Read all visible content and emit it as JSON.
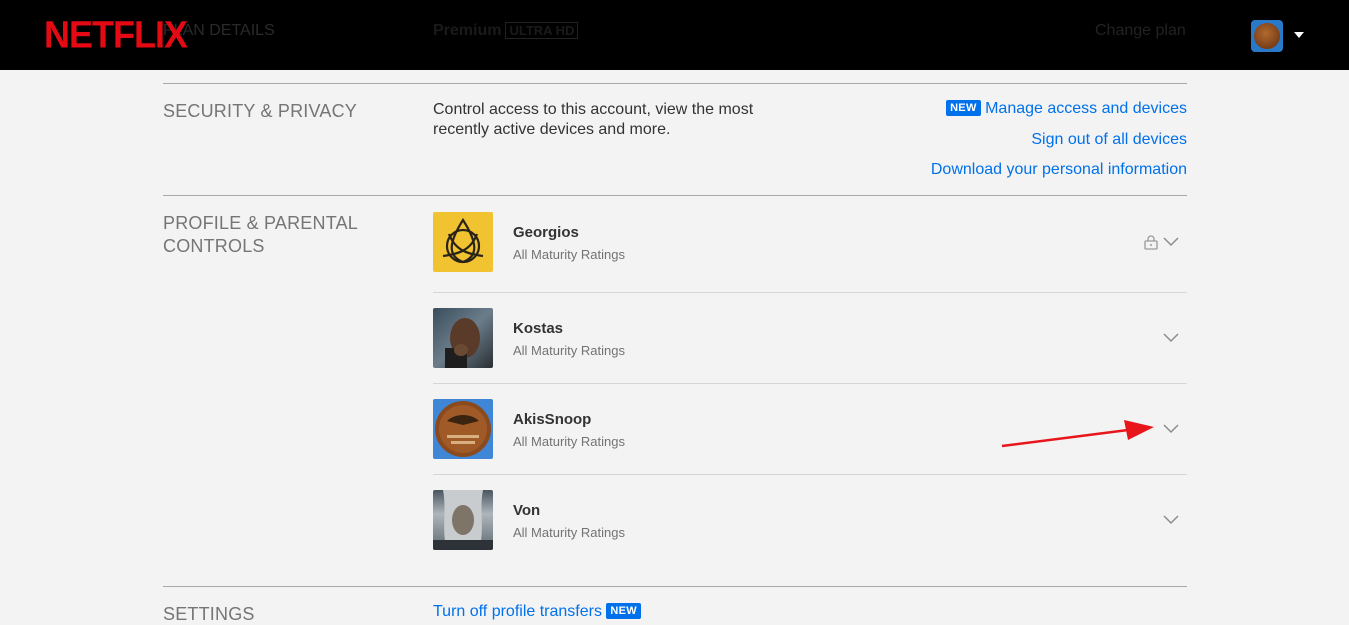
{
  "header": {
    "logo": "NETFLIX",
    "plan_label": "PLAN DETAILS",
    "plan_value": "Premium",
    "plan_badge": "ULTRA HD",
    "change_plan": "Change plan",
    "profile_menu_icon": "avatar-dropdown-icon"
  },
  "security": {
    "title": "SECURITY & PRIVACY",
    "description": "Control access to this account, view the most recently active devices and more.",
    "new_badge": "NEW",
    "manage_link": "Manage access and devices",
    "signout_link": "Sign out of all devices",
    "download_link": "Download your personal information"
  },
  "profiles": {
    "title_line1": "PROFILE & PARENTAL",
    "title_line2": "CONTROLS",
    "items": [
      {
        "name": "Georgios",
        "rating": "All Maturity Ratings",
        "locked": true
      },
      {
        "name": "Kostas",
        "rating": "All Maturity Ratings",
        "locked": false
      },
      {
        "name": "AkisSnoop",
        "rating": "All Maturity Ratings",
        "locked": false
      },
      {
        "name": "Von",
        "rating": "All Maturity Ratings",
        "locked": false
      }
    ]
  },
  "settings": {
    "title": "SETTINGS",
    "transfer_link": "Turn off profile transfers",
    "new_badge": "NEW"
  },
  "colors": {
    "brand": "#e50914",
    "link": "#0071eb",
    "annotation_arrow": "#e8161b"
  }
}
